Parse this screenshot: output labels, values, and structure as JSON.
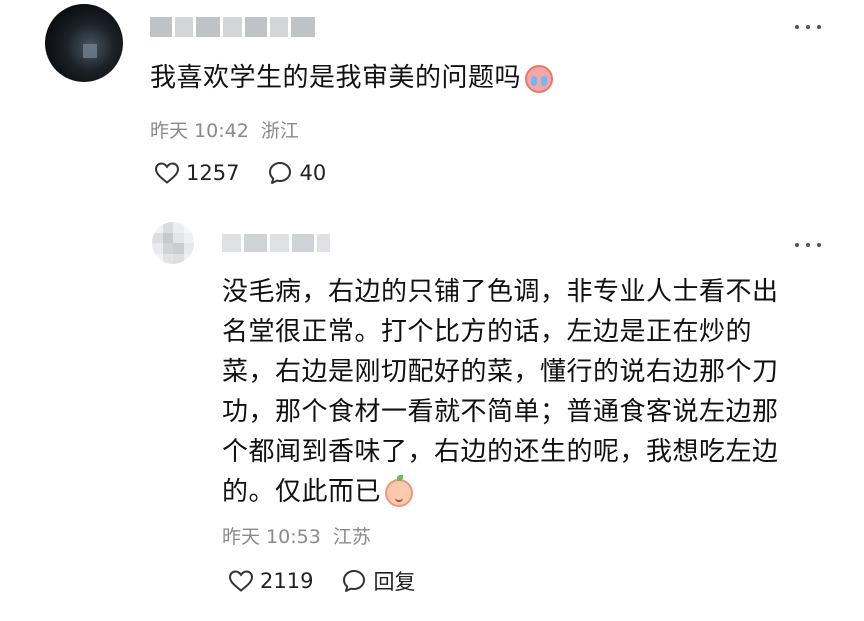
{
  "comment": {
    "username": "",
    "text": "我喜欢学生的是我审美的问题吗",
    "emoji_icon": "crying-face-icon",
    "time": "昨天 10:42",
    "location": "浙江",
    "likes": "1257",
    "replies": "40"
  },
  "reply": {
    "username": "",
    "lines": [
      "没毛病，右边的只铺了色调，非专业人士看不出",
      "名堂很正常。打个比方的话，左边是正在炒的",
      "菜，右边是刚切配好的菜，懂行的说右边那个刀",
      "功，那个食材一看就不简单；普通食客说左边那",
      "个都闻到香味了，右边的还生的呢，我想吃左边",
      "的。仅此而已"
    ],
    "emoji_icon": "peach-smile-icon",
    "time": "昨天 10:53",
    "location": "江苏",
    "likes": "2119",
    "reply_label": "回复"
  },
  "icons": {
    "more": "more-dots-icon",
    "like": "heart-outline-icon",
    "comment": "speech-bubble-icon"
  },
  "colors": {
    "text": "#111111",
    "meta": "#8a8a8a",
    "icon": "#333333"
  }
}
